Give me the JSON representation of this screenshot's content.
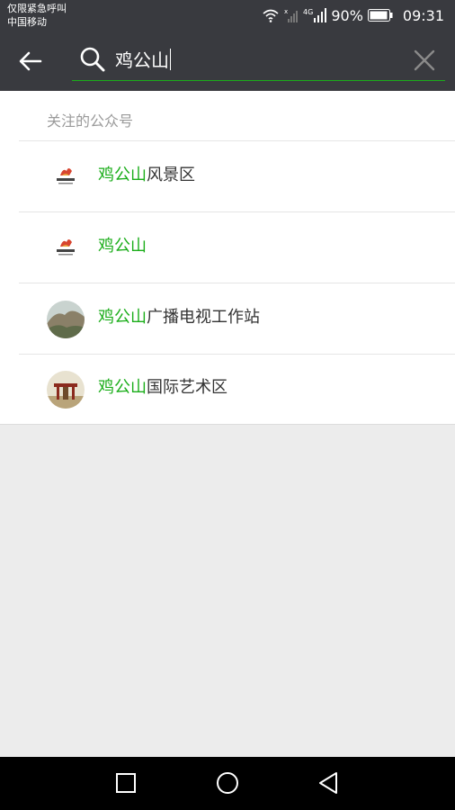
{
  "status_bar": {
    "carrier_line1": "仅限紧急呼叫",
    "carrier_line2": "中国移动",
    "network": "4G",
    "battery": "90%",
    "time": "09:31",
    "icons": [
      "wifi-icon",
      "signal-icon",
      "battery-icon"
    ]
  },
  "search": {
    "query": "鸡公山",
    "back_icon": "arrow-left-icon",
    "clear_icon": "close-icon"
  },
  "results": {
    "section_title": "关注的公众号",
    "items": [
      {
        "highlight": "鸡公山",
        "rest": "风景区",
        "avatar": "logo-avatar"
      },
      {
        "highlight": "鸡公山",
        "rest": "",
        "avatar": "logo-avatar"
      },
      {
        "highlight": "鸡公山",
        "rest": "广播电视工作站",
        "avatar": "photo-avatar"
      },
      {
        "highlight": "鸡公山",
        "rest": "国际艺术区",
        "avatar": "photo-avatar"
      }
    ]
  },
  "nav_bar": {
    "buttons": [
      "recent-apps-icon",
      "home-icon",
      "back-icon"
    ]
  },
  "colors": {
    "header_bg": "#393a3f",
    "accent_green": "#1aad19",
    "page_bg": "#ececec"
  }
}
